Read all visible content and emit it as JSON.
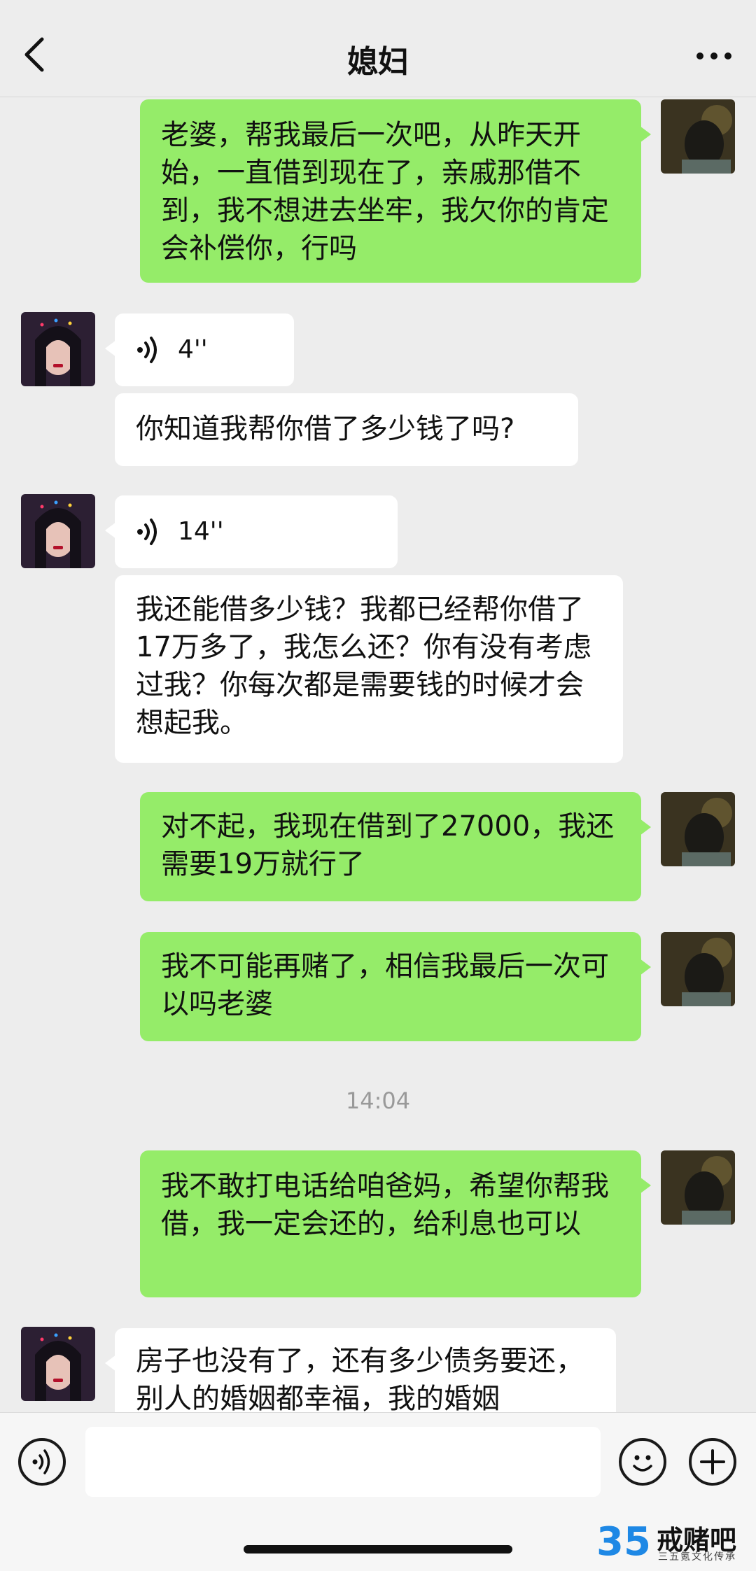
{
  "header": {
    "title": "媳妇"
  },
  "messages": [
    {
      "from": "me",
      "text": "老婆，帮我最后一次吧，从昨天开始，一直借到现在了，亲戚那借不到，我不想进去坐牢，我欠你的肯定会补偿你，行吗"
    },
    {
      "from": "other",
      "voice_duration": "4''"
    },
    {
      "from": "other",
      "text": "你知道我帮你借了多少钱了吗?"
    },
    {
      "from": "other",
      "voice_duration": "14''"
    },
    {
      "from": "other",
      "text": "我还能借多少钱？我都已经帮你借了17万多了，我怎么还？你有没有考虑过我？你每次都是需要钱的时候才会想起我。"
    },
    {
      "from": "me",
      "text": "对不起，我现在借到了27000，我还需要19万就行了"
    },
    {
      "from": "me",
      "text": "我不可能再赌了，相信我最后一次可以吗老婆"
    },
    {
      "timestamp": "14:04"
    },
    {
      "from": "me",
      "text": "我不敢打电话给咱爸妈，希望你帮我借，我一定会还的，给利息也可以"
    },
    {
      "from": "other",
      "text": "房子也没有了，还有多少债务要还，别人的婚姻都幸福，我的婚姻"
    }
  ],
  "input": {
    "placeholder": ""
  },
  "watermark": {
    "number": "35",
    "text": "戒赌吧",
    "sub": "三五氪文化传承"
  },
  "colors": {
    "my_bubble": "#95ec69",
    "other_bubble": "#ffffff",
    "background": "#ededed"
  }
}
